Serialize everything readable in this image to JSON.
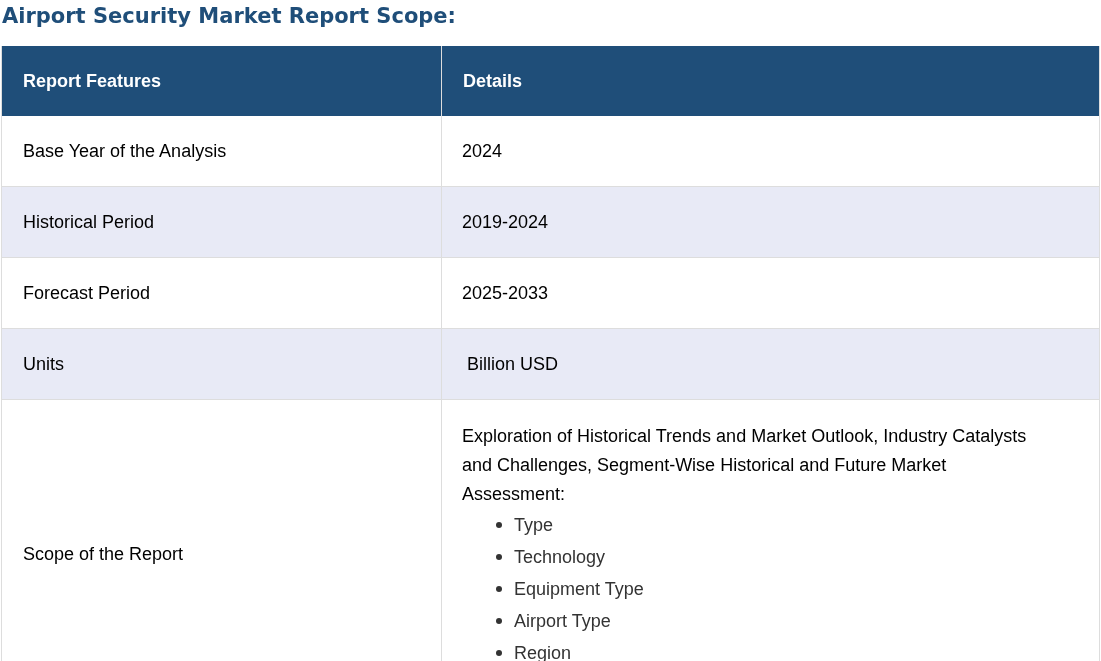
{
  "title": "Airport Security Market Report Scope:",
  "table": {
    "columns": [
      "Report Features",
      "Details"
    ],
    "rows": [
      {
        "feature": "Base Year of the Analysis",
        "details": "2024"
      },
      {
        "feature": "Historical Period",
        "details": "2019-2024"
      },
      {
        "feature": "Forecast Period",
        "details": "2025-2033"
      },
      {
        "feature": "Units",
        "details": " Billion USD"
      },
      {
        "feature": "Scope of the Report",
        "details": "Exploration of Historical Trends and Market Outlook, Industry Catalysts and Challenges, Segment-Wise Historical and Future Market Assessment:",
        "items": [
          "Type",
          "Technology",
          "Equipment Type",
          "Airport Type",
          "Region"
        ]
      }
    ]
  }
}
